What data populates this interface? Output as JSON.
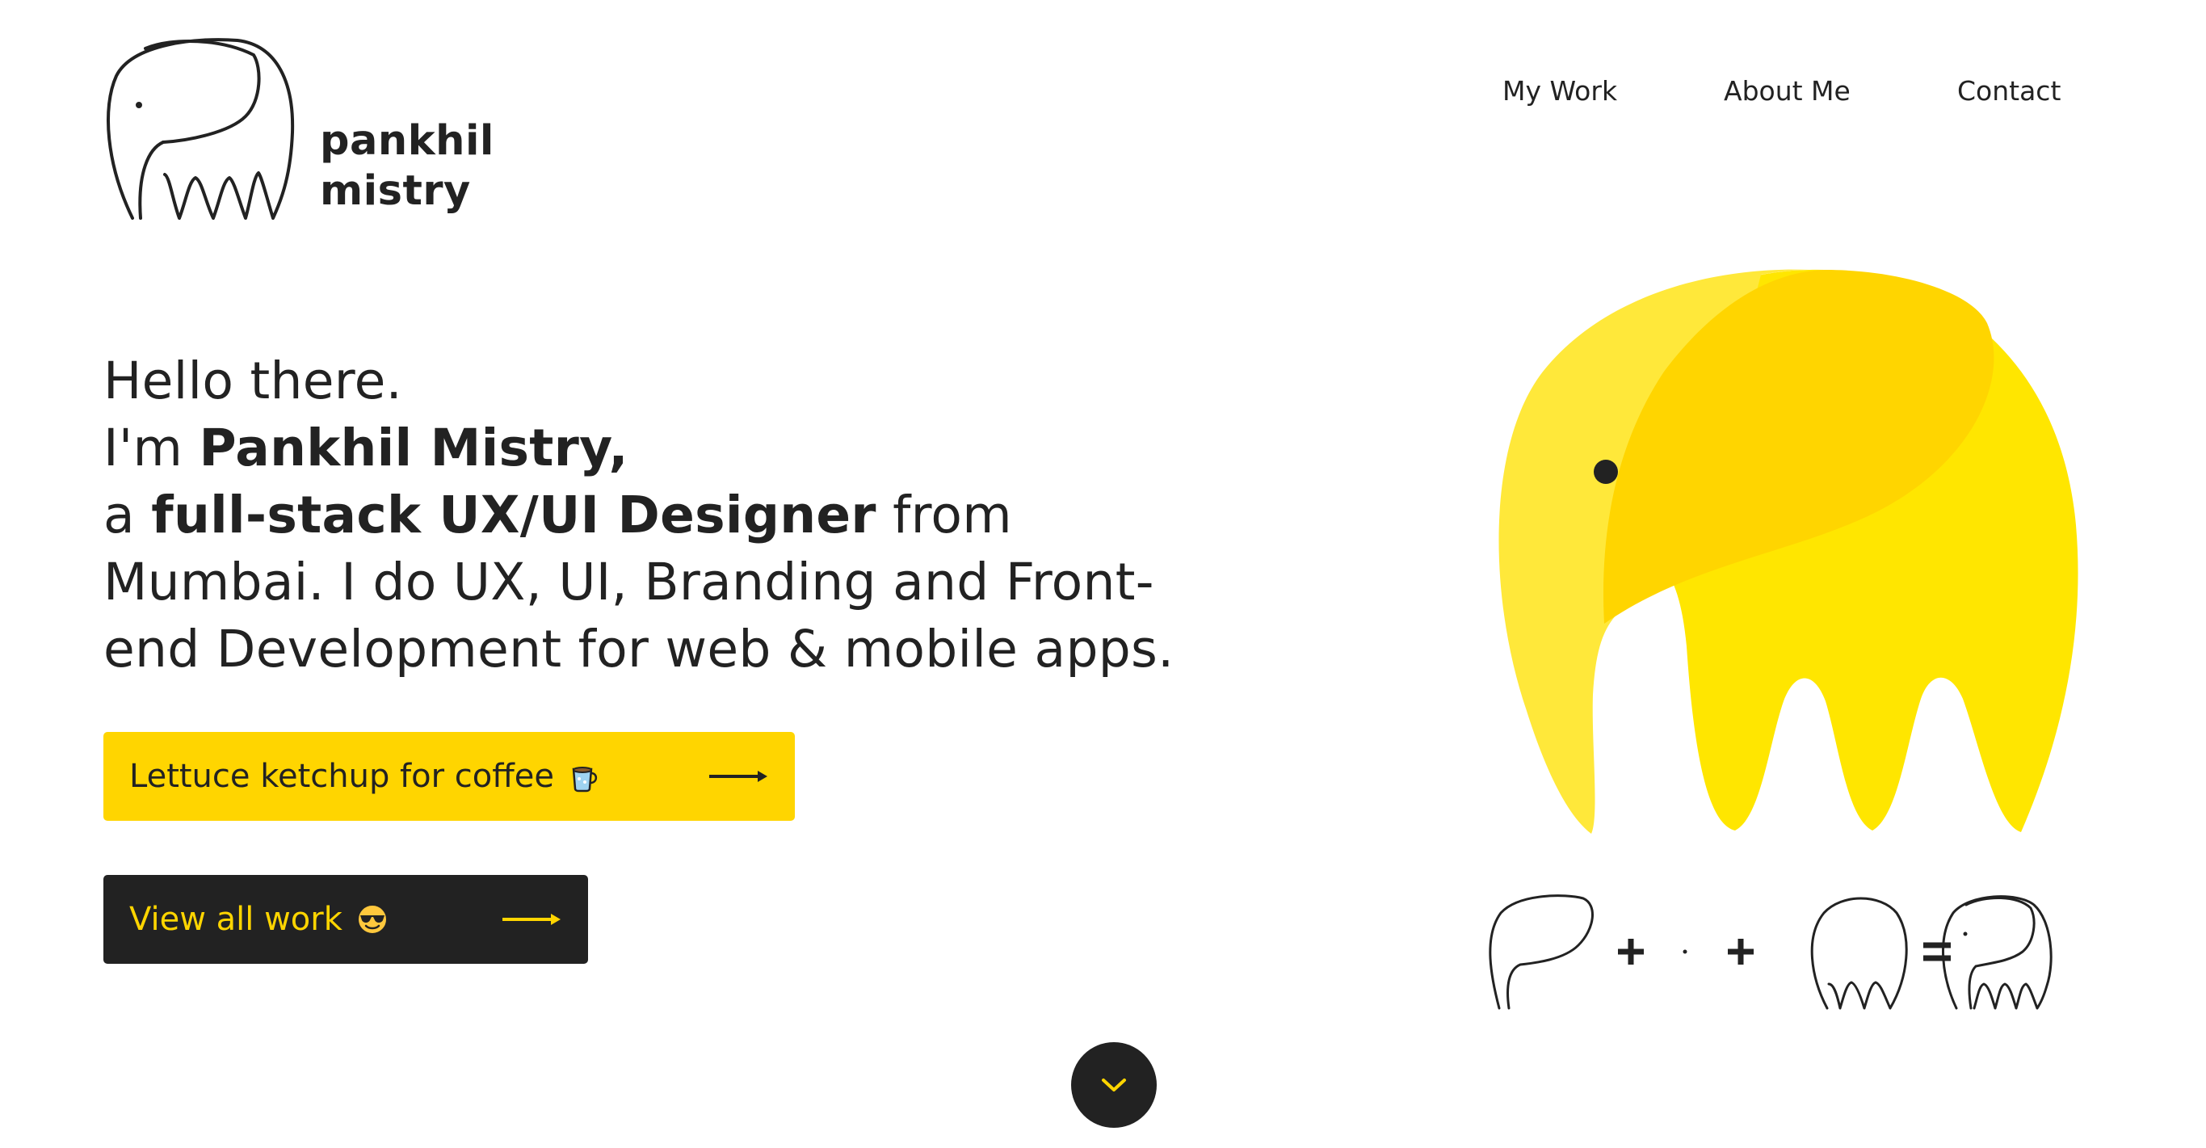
{
  "brand": {
    "line1": "pankhil",
    "line2": "mistry",
    "logo_icon": "elephant-outline-icon"
  },
  "nav": {
    "items": [
      {
        "label": "My Work"
      },
      {
        "label": "About Me"
      },
      {
        "label": "Contact"
      }
    ]
  },
  "hero": {
    "line1": "Hello there.",
    "line2_prefix": "I'm ",
    "name": "Pankhil Mistry,",
    "line3_prefix": "a ",
    "role": "full-stack UX/UI Designer",
    "line3_suffix": " from",
    "line4": "Mumbai. I do UX, UI, Branding and Front-",
    "line5": "end Development for web & mobile apps."
  },
  "buttons": {
    "coffee": {
      "label": "Lettuce ketchup for coffee",
      "icon": "coffee-mug-icon"
    },
    "work": {
      "label": "View all work",
      "icon": "sunglasses-face-icon"
    }
  },
  "scroll": {
    "icon": "chevron-down-icon"
  },
  "colors": {
    "accent": "#ffd500",
    "dark": "#222222",
    "elephant_light": "#ffe83a",
    "elephant_mid": "#ffd500",
    "elephant_body": "#ffe600"
  }
}
